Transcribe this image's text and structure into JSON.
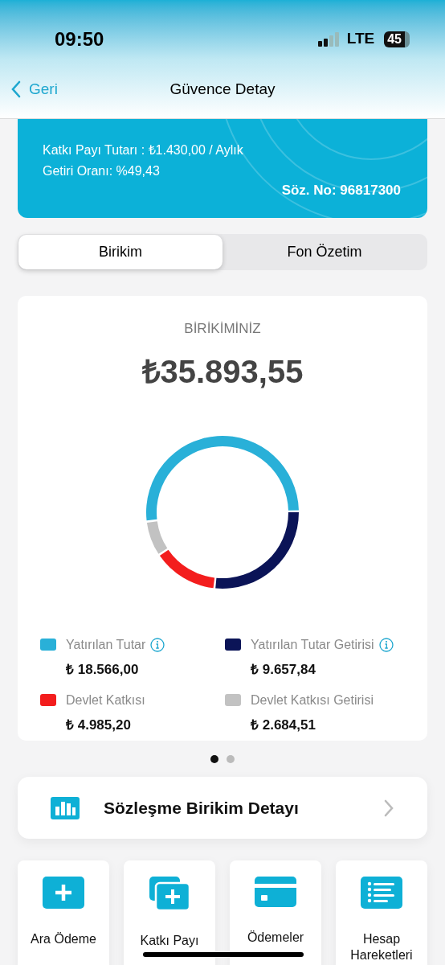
{
  "status_bar": {
    "time": "09:50",
    "network": "LTE",
    "battery": "45"
  },
  "nav": {
    "back": "Geri",
    "title": "Güvence Detay"
  },
  "contract_card": {
    "lines": [
      "Katkı Payı Tutarı : ₺1.430,00 / Aylık",
      "Getiri Oranı: %49,43"
    ],
    "contract_no": "Söz. No: 96817300"
  },
  "tabs": [
    {
      "label": "Birikim",
      "selected": true
    },
    {
      "label": "Fon Özetim",
      "selected": false
    }
  ],
  "savings": {
    "label": "BİRİKİMİNİZ",
    "total": "₺35.893,55",
    "chart_data": {
      "type": "donut",
      "categories": [
        "Yatırılan Tutar",
        "Yatırılan Tutar Getirisi",
        "Devlet Katkısı",
        "Devlet Katkısı Getirisi"
      ],
      "series": [
        {
          "values": [
            51.73,
            26.91,
            13.89,
            7.47
          ]
        }
      ]
    },
    "legend": [
      {
        "value": "₺ 18.566,00",
        "color": "#29b0d8",
        "info": true
      },
      {
        "value": "₺ 9.657,84",
        "color": "#0b1457",
        "info": true
      },
      {
        "value": "₺ 4.985,20",
        "color": "#f31d1d",
        "info": false
      },
      {
        "value": "₺ 2.684,51",
        "color": "#c2c2c2",
        "info": false
      }
    ]
  },
  "pager": [
    {
      "selected": true
    },
    {
      "selected": false
    }
  ],
  "detail_row": {
    "label": "Sözleşme Birikim Detayı"
  },
  "actions": [
    {
      "kind": "plus",
      "label": "Ara Ödeme"
    },
    {
      "kind": "stack",
      "label": "Katkı Payı"
    },
    {
      "kind": "card",
      "label": "Ödemeler"
    },
    {
      "kind": "list",
      "label": "Hesap Hareketleri"
    }
  ]
}
